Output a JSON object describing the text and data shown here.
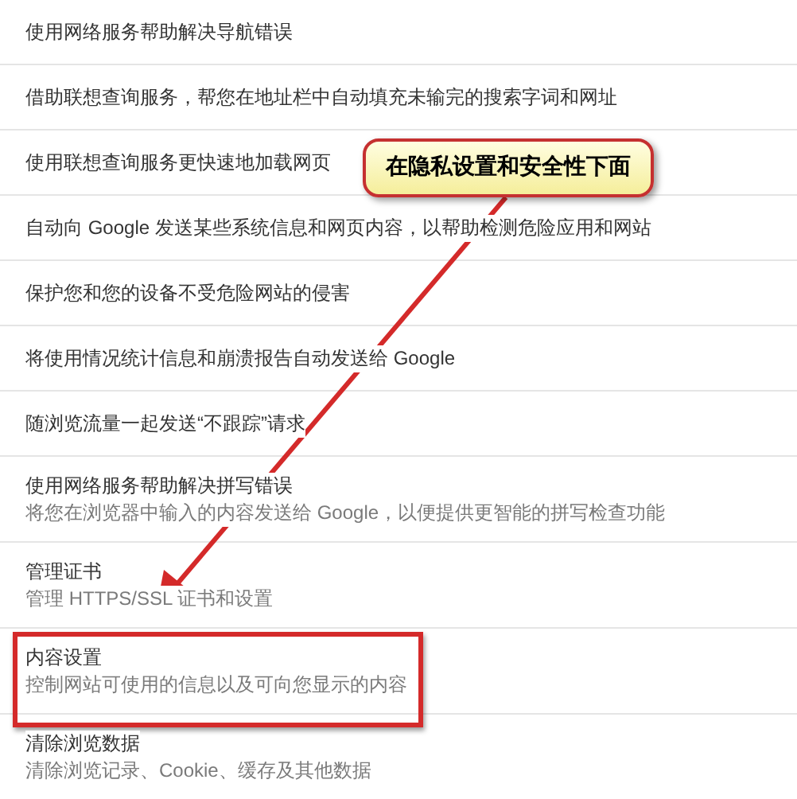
{
  "settings": [
    {
      "title": "使用网络服务帮助解决导航错误",
      "highlighted": false
    },
    {
      "title": "借助联想查询服务，帮您在地址栏中自动填充未输完的搜索字词和网址",
      "highlighted": false
    },
    {
      "title": "使用联想查询服务更快速地加载网页",
      "highlighted": false
    },
    {
      "title": "自动向 Google 发送某些系统信息和网页内容，以帮助检测危险应用和网站",
      "highlighted": false
    },
    {
      "title": "保护您和您的设备不受危险网站的侵害",
      "highlighted": false
    },
    {
      "title": "将使用情况统计信息和崩溃报告自动发送给 Google",
      "highlighted": false
    },
    {
      "title": "随浏览流量一起发送“不跟踪”请求",
      "highlighted": false
    },
    {
      "title": "使用网络服务帮助解决拼写错误",
      "description": "将您在浏览器中输入的内容发送给 Google，以便提供更智能的拼写检查功能",
      "highlighted": false
    },
    {
      "title": "管理证书",
      "description": "管理 HTTPS/SSL 证书和设置",
      "highlighted": false
    },
    {
      "title": "内容设置",
      "description": "控制网站可使用的信息以及可向您显示的内容",
      "highlighted": true
    },
    {
      "title": "清除浏览数据",
      "description": "清除浏览记录、Cookie、缓存及其他数据",
      "highlighted": false
    }
  ],
  "callout": {
    "text": "在隐私设置和安全性下面"
  }
}
